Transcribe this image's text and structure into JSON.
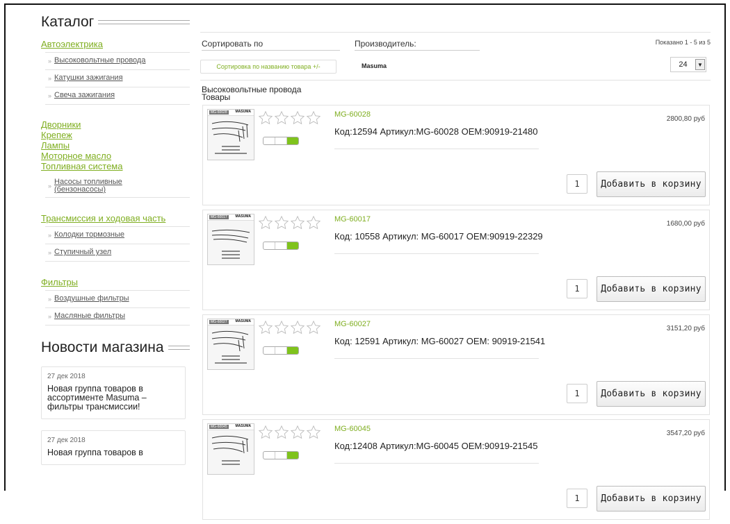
{
  "catalog": {
    "title": "Каталог",
    "groups": [
      {
        "label": "Автоэлектрика",
        "items": [
          "Высоковольтные провода",
          "Катушки зажигания",
          "Свеча зажигания"
        ]
      },
      {
        "label": "Дворники",
        "items": []
      },
      {
        "label": "Крепеж",
        "items": []
      },
      {
        "label": "Лампы",
        "items": []
      },
      {
        "label": "Моторное масло",
        "items": []
      },
      {
        "label": "Топливная система",
        "items": [
          "Насосы топливные (бензонасосы)"
        ]
      },
      {
        "label": "Трансмиссия и ходовая часть",
        "items": [
          "Колодки тормозные",
          "Ступичный узел"
        ]
      },
      {
        "label": "Фильтры",
        "items": [
          "Воздушные фильтры",
          "Масляные фильтры"
        ]
      }
    ]
  },
  "news": {
    "title": "Новости магазина",
    "items": [
      {
        "date": "27 дек 2018",
        "text": "Новая группа товаров в ассортименте Masuma – фильтры трансмиссии!"
      },
      {
        "date": "27 дек 2018",
        "text": "Новая группа товаров в"
      }
    ]
  },
  "toolbar": {
    "sort_label": "Сортировать по",
    "manufacturer_label": "Производитель:",
    "shown": "Показано 1 - 5 из 5",
    "sort_button": "Сортировка по названию товара +/-",
    "manufacturer_value": "Masuma",
    "per_page": "24"
  },
  "category_heading": {
    "line1": "Высоковольтные провода",
    "line2": "Товары"
  },
  "products": [
    {
      "thumb_code": "MG-60028",
      "thumb_brand": "MASUMA",
      "name": "MG-60028",
      "desc": "Код:12594 Артикул:MG-60028 OEM:90919-21480",
      "price": "2800,80 руб",
      "qty": "1",
      "add_label": "Добавить в корзину"
    },
    {
      "thumb_code": "MG-60017",
      "thumb_brand": "MASUMA",
      "name": "MG-60017",
      "desc": "Код: 10558 Артикул: MG-60017 OEM:90919-22329",
      "price": "1680,00 руб",
      "qty": "1",
      "add_label": "Добавить в корзину"
    },
    {
      "thumb_code": "MG-60027",
      "thumb_brand": "MASUMA",
      "name": "MG-60027",
      "desc": "Код: 12591 Артикул: MG-60027 OEM: 90919-21541",
      "price": "3151,20 руб",
      "qty": "1",
      "add_label": "Добавить в корзину"
    },
    {
      "thumb_code": "MG-60045",
      "thumb_brand": "MASUMA",
      "name": "MG-60045",
      "desc": "Код:12408 Артикул:MG-60045 OEM:90919-21545",
      "price": "3547,20 руб",
      "qty": "1",
      "add_label": "Добавить в корзину"
    }
  ],
  "colors": {
    "accent_green": "#7fae20",
    "stock_green": "#7fc31c"
  }
}
